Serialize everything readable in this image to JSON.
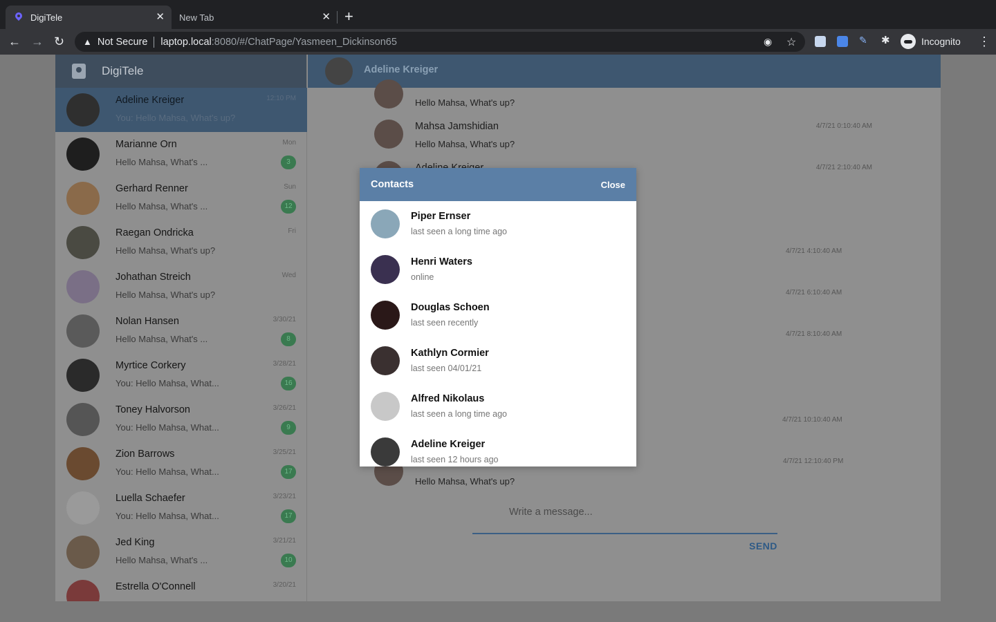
{
  "browser": {
    "active_tab_title": "DigiTele",
    "inactive_tab_title": "New Tab",
    "security_label": "Not Secure",
    "url_host": "laptop.local",
    "url_path": ":8080/#/ChatPage/Yasmeen_Dickinson65",
    "profile_label": "Incognito"
  },
  "sidebar": {
    "app_title": "DigiTele",
    "chats": [
      {
        "name": "Adeline Kreiger",
        "preview": "You: Hello Mahsa, What's up?",
        "time": "12:10 PM",
        "badge": "",
        "avatar_color": "#2f2f2f"
      },
      {
        "name": "Marianne Orn",
        "preview": "Hello Mahsa, What's ...",
        "time": "Mon",
        "badge": "3",
        "avatar_color": "#1e1e1e"
      },
      {
        "name": "Gerhard Renner",
        "preview": "Hello Mahsa, What's ...",
        "time": "Sun",
        "badge": "12",
        "avatar_color": "#8a6a4a"
      },
      {
        "name": "Raegan Ondricka",
        "preview": "Hello Mahsa, What's up?",
        "time": "Fri",
        "badge": "",
        "avatar_color": "#4a4a42"
      },
      {
        "name": "Johathan Streich",
        "preview": "Hello Mahsa, What's up?",
        "time": "Wed",
        "badge": "",
        "avatar_color": "#7a6f86"
      },
      {
        "name": "Nolan Hansen",
        "preview": "Hello Mahsa, What's ...",
        "time": "3/30/21",
        "badge": "8",
        "avatar_color": "#5a5a5a"
      },
      {
        "name": "Myrtice Corkery",
        "preview": "You: Hello Mahsa, What...",
        "time": "3/28/21",
        "badge": "16",
        "avatar_color": "#2a2a2a"
      },
      {
        "name": "Toney Halvorson",
        "preview": "You: Hello Mahsa, What...",
        "time": "3/26/21",
        "badge": "9",
        "avatar_color": "#555555"
      },
      {
        "name": "Zion Barrows",
        "preview": "You: Hello Mahsa, What...",
        "time": "3/25/21",
        "badge": "17",
        "avatar_color": "#6a4a30"
      },
      {
        "name": "Luella Schaefer",
        "preview": "You: Hello Mahsa, What...",
        "time": "3/23/21",
        "badge": "17",
        "avatar_color": "#9a9a9a"
      },
      {
        "name": "Jed King",
        "preview": "Hello Mahsa, What's ...",
        "time": "3/21/21",
        "badge": "10",
        "avatar_color": "#6a5a4a"
      },
      {
        "name": "Estrella O'Connell",
        "preview": "",
        "time": "3/20/21",
        "badge": "",
        "avatar_color": "#7a3a3a"
      }
    ]
  },
  "conversation": {
    "contact_name": "Adeline Kreiger",
    "messages": [
      {
        "sender": "Mahsa Jamshidian",
        "text": "Hello Mahsa, What's up?",
        "time": ""
      },
      {
        "sender": "Mahsa Jamshidian",
        "text": "Hello Mahsa, What's up?",
        "time": "4/7/21 0:10:40 AM"
      },
      {
        "sender": "Adeline Kreiger",
        "text": "",
        "time": "4/7/21 2:10:40 AM"
      }
    ],
    "hidden_timestamps": [
      "4/7/21 4:10:40 AM",
      "4/7/21 6:10:40 AM",
      "4/7/21 8:10:40 AM",
      "4/7/21 10:10:40 AM",
      "4/7/21 12:10:40 PM"
    ],
    "last_message": {
      "sender": "Mahsa Jamshidian",
      "text": "Hello Mahsa, What's up?"
    },
    "compose_placeholder": "Write a message...",
    "send_label": "SEND"
  },
  "contacts_modal": {
    "title": "Contacts",
    "close_label": "Close",
    "contacts": [
      {
        "name": "Piper Ernser",
        "status": "last seen a long time ago",
        "avatar_color": "#8aa7b8"
      },
      {
        "name": "Henri Waters",
        "status": "online",
        "avatar_color": "#3a3050"
      },
      {
        "name": "Douglas Schoen",
        "status": "last seen recently",
        "avatar_color": "#2a1818"
      },
      {
        "name": "Kathlyn Cormier",
        "status": "last seen 04/01/21",
        "avatar_color": "#3a3030"
      },
      {
        "name": "Alfred Nikolaus",
        "status": "last seen a long time ago",
        "avatar_color": "#c8c8c8"
      },
      {
        "name": "Adeline Kreiger",
        "status": "last seen 12 hours ago",
        "avatar_color": "#3a3a3a"
      }
    ]
  }
}
